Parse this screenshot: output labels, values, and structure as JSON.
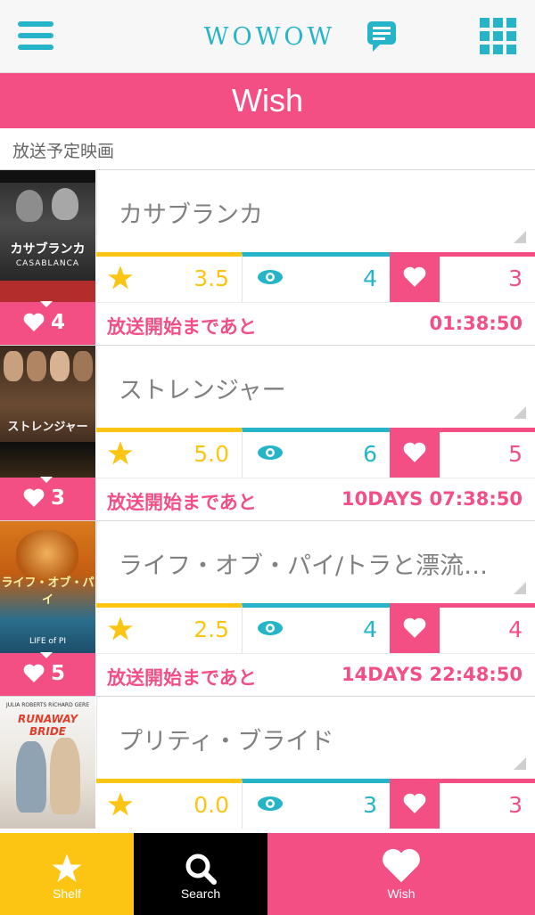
{
  "app": {
    "logo": "WOWOW"
  },
  "header": {
    "title": "Wish"
  },
  "section": {
    "title": "放送予定映画"
  },
  "countdown_label": "放送開始まであと",
  "movies": [
    {
      "title": "カサブランカ",
      "poster_text": "カサブランカ",
      "poster_subtext": "CASABLANCA",
      "wish_count": "4",
      "rating": "3.5",
      "views": "4",
      "likes": "3",
      "time_left": "01:38:50"
    },
    {
      "title": "ストレンジャー",
      "poster_text": "ストレンジャー",
      "wish_count": "3",
      "rating": "5.0",
      "views": "6",
      "likes": "5",
      "time_left": "10DAYS 07:38:50"
    },
    {
      "title": "ライフ・オブ・パイ/トラと漂流…",
      "poster_text": "ライフ・オブ・パイ",
      "poster_subtext": "LIFE of PI",
      "wish_count": "5",
      "rating": "2.5",
      "views": "4",
      "likes": "4",
      "time_left": "14DAYS 22:48:50"
    },
    {
      "title": "プリティ・ブライド",
      "poster_text": "RUNAWAY BRIDE",
      "poster_subtext": "JULIA ROBERTS RICHARD GERE",
      "rating": "0.0",
      "views": "3",
      "likes": "3"
    }
  ],
  "tabs": [
    {
      "label": "Shelf"
    },
    {
      "label": "Search"
    },
    {
      "label": "Wish"
    }
  ],
  "colors": {
    "pink": "#f34f85",
    "teal": "#26b5c8",
    "yellow": "#fdc513",
    "gray_text": "#808080"
  }
}
